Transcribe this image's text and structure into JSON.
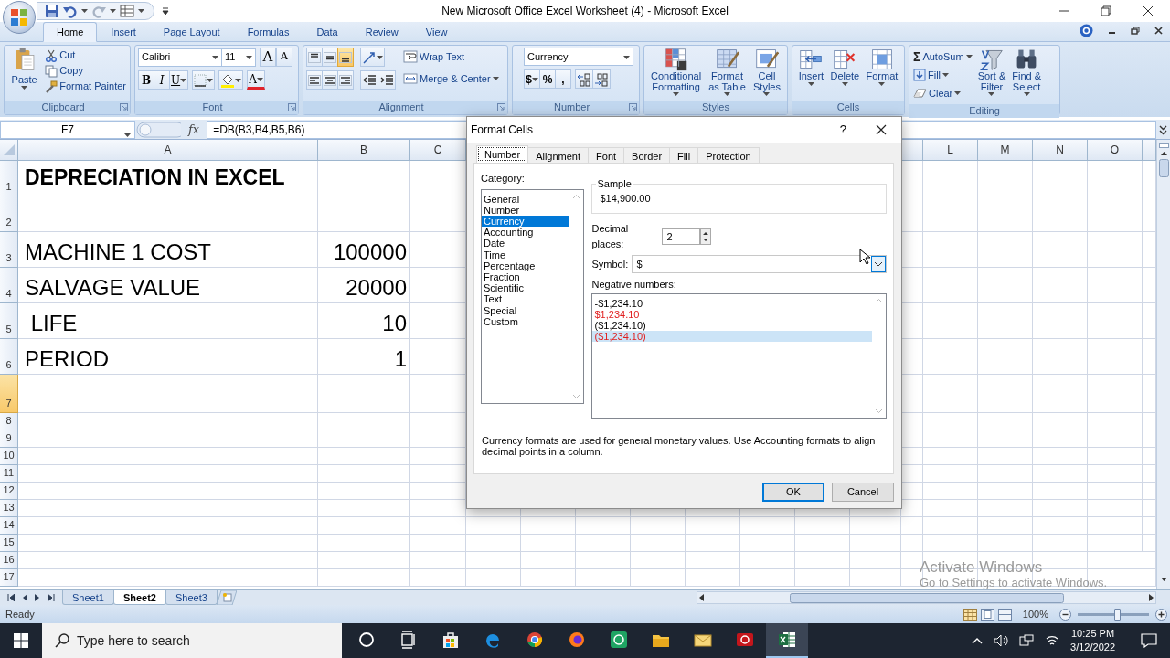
{
  "window": {
    "title": "New Microsoft Office Excel Worksheet (4) - Microsoft Excel"
  },
  "ribbon_tabs": [
    {
      "label": "Home",
      "selected": true
    },
    {
      "label": "Insert",
      "selected": false
    },
    {
      "label": "Page Layout",
      "selected": false
    },
    {
      "label": "Formulas",
      "selected": false
    },
    {
      "label": "Data",
      "selected": false
    },
    {
      "label": "Review",
      "selected": false
    },
    {
      "label": "View",
      "selected": false
    }
  ],
  "clipboard": {
    "label": "Clipboard",
    "paste": "Paste",
    "tools": [
      {
        "kind": "cut",
        "label": "Cut"
      },
      {
        "kind": "copy",
        "label": "Copy"
      },
      {
        "kind": "painter",
        "label": "Format Painter"
      }
    ]
  },
  "font": {
    "label": "Font",
    "name": "Calibri",
    "size": "11",
    "grow": "A",
    "shrink": "A",
    "bold": "B",
    "italic": "I",
    "underline": "U",
    "font_color": "A"
  },
  "alignment": {
    "label": "Alignment",
    "vertical": [
      {
        "selected": false
      },
      {
        "selected": false
      },
      {
        "selected": true
      }
    ],
    "wrap": "Wrap Text",
    "merge": "Merge & Center"
  },
  "number": {
    "label": "Number",
    "format": "Currency",
    "currency": "$",
    "percent": "%",
    "comma": ","
  },
  "styles": {
    "label": "Styles",
    "buttons": [
      {
        "kind": "conditional",
        "lines": [
          "Conditional",
          "Formatting"
        ]
      },
      {
        "kind": "table",
        "lines": [
          "Format",
          "as Table"
        ]
      },
      {
        "kind": "cell_styles",
        "lines": [
          "Cell",
          "Styles"
        ]
      }
    ]
  },
  "cells": {
    "label": "Cells",
    "buttons": [
      {
        "kind": "insert",
        "lines": [
          "Insert"
        ]
      },
      {
        "kind": "delete",
        "lines": [
          "Delete"
        ]
      },
      {
        "kind": "format",
        "lines": [
          "Format"
        ]
      }
    ]
  },
  "editing": {
    "label": "Editing",
    "tools": [
      {
        "kind": "autosum",
        "symbol": "Σ",
        "label": "AutoSum"
      },
      {
        "kind": "fill",
        "label": "Fill"
      },
      {
        "kind": "clear",
        "label": "Clear"
      }
    ],
    "buttons": [
      {
        "kind": "sort",
        "lines": [
          "Sort &",
          "Filter"
        ]
      },
      {
        "kind": "find",
        "lines": [
          "Find &",
          "Select"
        ]
      }
    ]
  },
  "formula_bar": {
    "name_box": "F7",
    "fx": "fx",
    "formula": "=DB(B3,B4,B5,B6)"
  },
  "columns": [
    {
      "label": "A"
    },
    {
      "label": "B"
    },
    {
      "label": "C"
    },
    {
      "label": "L"
    },
    {
      "label": "M"
    },
    {
      "label": "N"
    },
    {
      "label": "O"
    }
  ],
  "rows": [
    {
      "label": "1",
      "kind": "heading",
      "selected": false,
      "a": "DEPRECIATION IN EXCEL"
    },
    {
      "label": "2",
      "kind": "data",
      "selected": false
    },
    {
      "label": "3",
      "kind": "data",
      "selected": false,
      "a": "MACHINE 1 COST",
      "b": "100000"
    },
    {
      "label": "4",
      "kind": "data",
      "selected": false,
      "a": "SALVAGE VALUE",
      "b": "20000"
    },
    {
      "label": "5",
      "kind": "data",
      "selected": false,
      "a": " LIFE",
      "b": "10"
    },
    {
      "label": "6",
      "kind": "data",
      "selected": false,
      "a": "PERIOD",
      "b": "1"
    },
    {
      "label": "7",
      "kind": "data",
      "selected": true
    },
    {
      "label": "8",
      "kind": "data",
      "selected": false
    },
    {
      "label": "9",
      "kind": "data",
      "selected": false
    },
    {
      "label": "10",
      "kind": "data",
      "selected": false
    },
    {
      "label": "11",
      "kind": "data",
      "selected": false
    },
    {
      "label": "12",
      "kind": "data",
      "selected": false
    },
    {
      "label": "13",
      "kind": "data",
      "selected": false
    },
    {
      "label": "14",
      "kind": "data",
      "selected": false
    },
    {
      "label": "15",
      "kind": "data",
      "selected": false
    },
    {
      "label": "16",
      "kind": "data",
      "selected": false
    },
    {
      "label": "17",
      "kind": "data",
      "selected": false
    }
  ],
  "sheet_tabs": [
    {
      "label": "Sheet1",
      "selected": false
    },
    {
      "label": "Sheet2",
      "selected": true
    },
    {
      "label": "Sheet3",
      "selected": false
    }
  ],
  "status_bar": {
    "text": "Ready",
    "zoom": "100%",
    "zoom_slider": {
      "level": 0.55
    }
  },
  "dialog": {
    "title": "Format Cells",
    "help": "?",
    "tabs": [
      {
        "label": "Number",
        "selected": true
      },
      {
        "label": "Alignment",
        "selected": false
      },
      {
        "label": "Font",
        "selected": false
      },
      {
        "label": "Border",
        "selected": false
      },
      {
        "label": "Fill",
        "selected": false
      },
      {
        "label": "Protection",
        "selected": false
      }
    ],
    "category_label": "Category:",
    "categories": [
      {
        "label": "General",
        "selected": false
      },
      {
        "label": "Number",
        "selected": false
      },
      {
        "label": "Currency",
        "selected": true
      },
      {
        "label": "Accounting",
        "selected": false
      },
      {
        "label": "Date",
        "selected": false
      },
      {
        "label": "Time",
        "selected": false
      },
      {
        "label": "Percentage",
        "selected": false
      },
      {
        "label": "Fraction",
        "selected": false
      },
      {
        "label": "Scientific",
        "selected": false
      },
      {
        "label": "Text",
        "selected": false
      },
      {
        "label": "Special",
        "selected": false
      },
      {
        "label": "Custom",
        "selected": false
      }
    ],
    "sample_label": "Sample",
    "sample": "$14,900.00",
    "decimal_label": "Decimal places:",
    "decimal_places": "2",
    "symbol_label": "Symbol:",
    "symbol": "$",
    "negative_label": "Negative numbers:",
    "negatives": [
      {
        "text": "-$1,234.10",
        "color": "#000000",
        "selected": false
      },
      {
        "text": "$1,234.10",
        "color": "#e02020",
        "selected": false
      },
      {
        "text": "($1,234.10)",
        "color": "#000000",
        "selected": false
      },
      {
        "text": "($1,234.10)",
        "color": "#e02020",
        "selected": true
      }
    ],
    "description": "Currency formats are used for general monetary values.  Use Accounting formats to align decimal points in a column.",
    "buttons": [
      {
        "label": "OK",
        "default": true
      },
      {
        "label": "Cancel",
        "default": false
      }
    ]
  },
  "activation_notice": {
    "title": "Activate Windows",
    "hint": "Go to Settings to activate Windows."
  },
  "taskbar": {
    "search_placeholder": "Type here to search",
    "apps": [
      {
        "kind": "circle",
        "active": false
      },
      {
        "kind": "taskview",
        "active": false
      },
      {
        "kind": "store",
        "active": false
      },
      {
        "kind": "edge",
        "active": false
      },
      {
        "kind": "chrome",
        "active": false
      },
      {
        "kind": "firefox",
        "active": false
      },
      {
        "kind": "chat",
        "active": false
      },
      {
        "kind": "folder",
        "active": false
      },
      {
        "kind": "mail",
        "active": false
      },
      {
        "kind": "camera",
        "active": false
      },
      {
        "kind": "spreadsheet",
        "active": true
      }
    ],
    "time": "10:25 PM",
    "date": "3/12/2022"
  }
}
